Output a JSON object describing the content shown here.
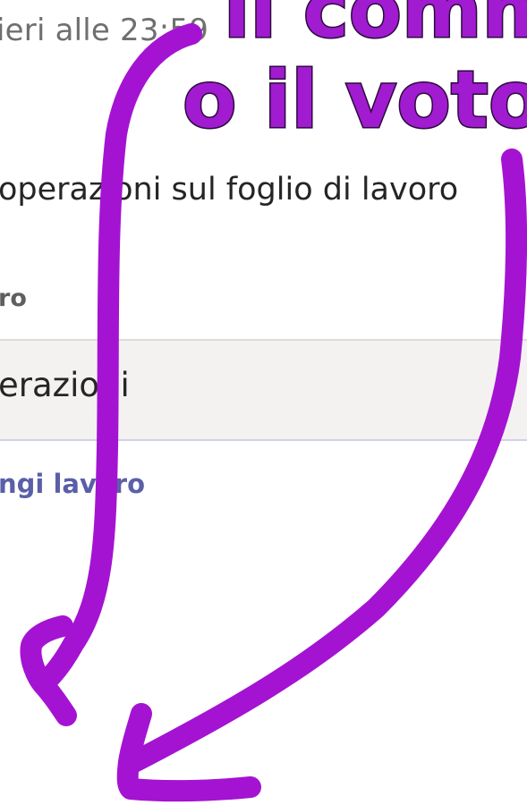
{
  "assignment": {
    "due_text": "ieri alle 23:59",
    "instructions_text": "operazioni sul foglio di lavoro",
    "work_heading": "ro",
    "attachment_name": "erazioni",
    "add_work_label": "ngi lavoro"
  },
  "annotation": {
    "line1": "il commen",
    "line2": "o il voto",
    "color": "#a11bd0",
    "outline_color": "#2b0b3d"
  }
}
